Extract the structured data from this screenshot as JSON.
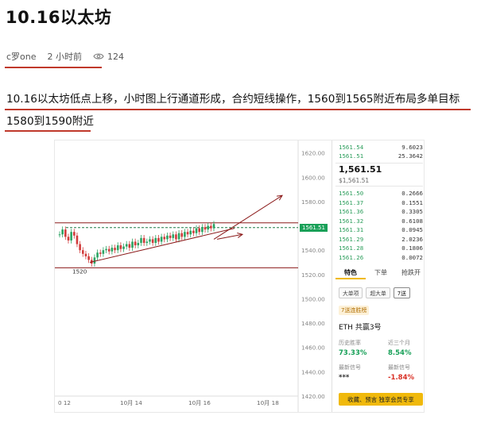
{
  "article": {
    "title": "10.16以太坊",
    "author": "c罗one",
    "time": "2 小时前",
    "views": "124",
    "body": "10.16以太坊低点上移，小时图上行通道形成，合约短线操作，1560到1565附近布局多单目标1580到1590附近"
  },
  "chart_data": {
    "type": "candlestick",
    "yticks": [
      "1620.00",
      "1600.00",
      "1580.00",
      "1560.00",
      "1540.00",
      "1520.00",
      "1500.00",
      "1480.00",
      "1460.00",
      "1440.00",
      "1420.00"
    ],
    "xticks": [
      "0 12",
      "10月 14",
      "10月 16",
      "10月 18"
    ],
    "ylim": [
      1420,
      1625
    ],
    "last_price_label": "1561.51",
    "low_label": "1520",
    "levels": {
      "resistance": 1562.5,
      "support": 1525.5
    },
    "series": [
      {
        "values": [
          1553,
          1557,
          1551,
          1548,
          1555,
          1552,
          1545,
          1540,
          1537,
          1535,
          1532,
          1529,
          1534,
          1538,
          1537,
          1540,
          1541,
          1539,
          1542,
          1540,
          1544,
          1541,
          1543,
          1545,
          1542,
          1547,
          1544,
          1546,
          1550,
          1546,
          1547,
          1549,
          1546,
          1550,
          1547,
          1551,
          1549,
          1552,
          1550,
          1553,
          1549,
          1554,
          1551,
          1555,
          1553,
          1556,
          1554,
          1558,
          1555,
          1559,
          1557,
          1560,
          1558,
          1561.5
        ]
      }
    ]
  },
  "side_panel": {
    "top_book": [
      {
        "price": "1561.54",
        "qty": "9.6023"
      },
      {
        "price": "1561.51",
        "qty": "25.3642"
      }
    ],
    "last_price": "1,561.51",
    "last_price_sub": "$1,561.51",
    "bids": [
      {
        "price": "1561.50",
        "qty": "0.2666"
      },
      {
        "price": "1561.37",
        "qty": "0.1551"
      },
      {
        "price": "1561.36",
        "qty": "0.3305"
      },
      {
        "price": "1561.32",
        "qty": "0.6108"
      },
      {
        "price": "1561.31",
        "qty": "0.0945"
      },
      {
        "price": "1561.29",
        "qty": "2.0236"
      },
      {
        "price": "1561.28",
        "qty": "0.1806"
      },
      {
        "price": "1561.26",
        "qty": "0.0072"
      }
    ],
    "tabs": [
      "特色",
      "下单",
      "抢跌开"
    ],
    "pills": [
      "大单项",
      "超大单",
      "7送"
    ],
    "tag": "7送连胜榜",
    "strategy": "ETH 共赢3号",
    "stat1_label": "历史胜率",
    "stat1_value": "73.33%",
    "stat2_label": "近三个月",
    "stat2_value": "8.54%",
    "stat3_label": "最新信号",
    "stat3_value": "***",
    "stat4_label": "最新信号",
    "stat4_value": "-1.84%",
    "cta": "收藏、预言 独享会员专享"
  }
}
